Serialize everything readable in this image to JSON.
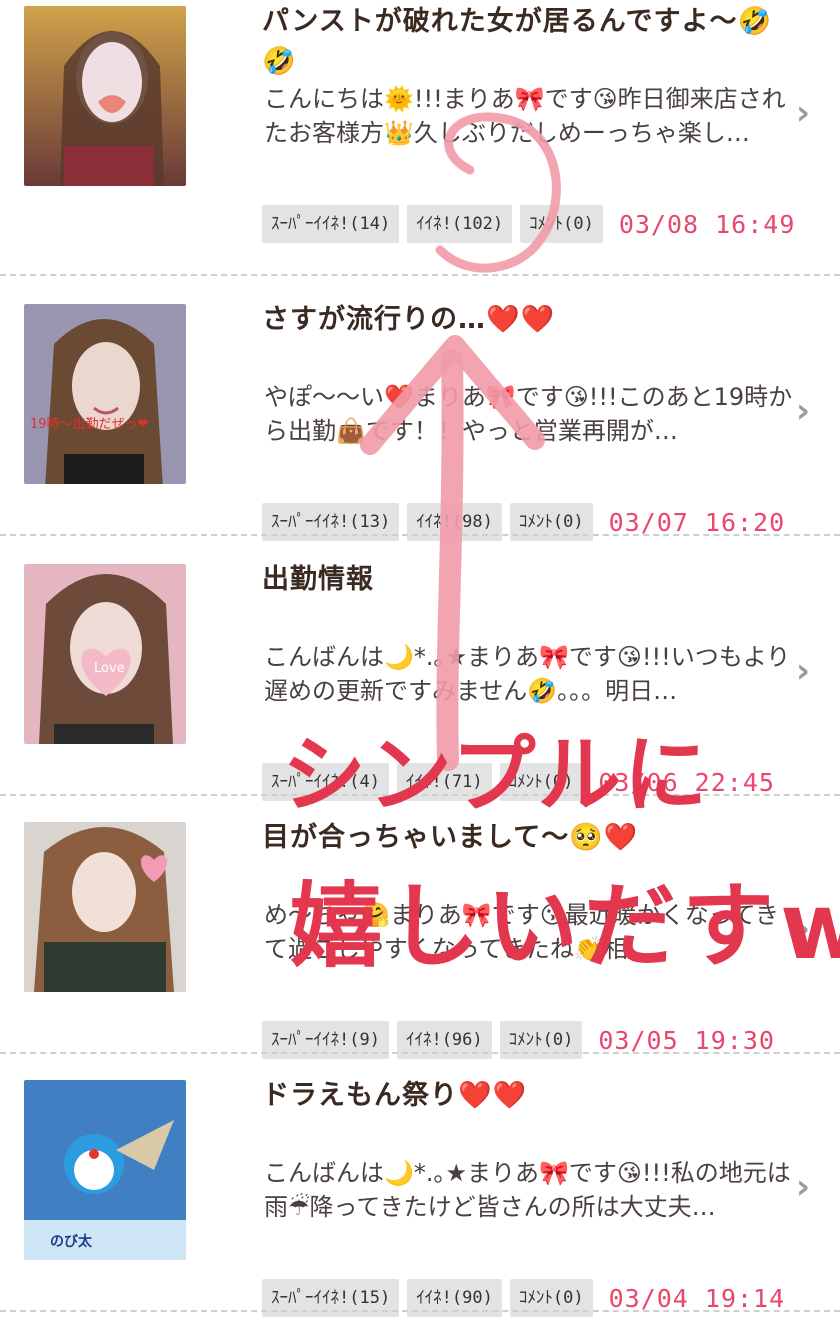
{
  "posts": [
    {
      "title": "パンストが破れた女が居るんですよ〜🤣🤣",
      "excerpt": "こんにちは🌞!!!まりあ🎀です😘昨日御来店されたお客様方👑久しぶりだしめーっちゃ楽し…",
      "super_like": "ｽｰﾊﾟｰｲｲﾈ!(14)",
      "like": "ｲｲﾈ!(102)",
      "comment": "ｺﾒﾝﾄ(0)",
      "date": "03/08 16:49",
      "thumb_color": "#c9a54b"
    },
    {
      "title": "さすが流行りの…❤️❤️",
      "excerpt": "やぽ〜〜い❤️まりあ🎀です😘!!!このあと19時から出勤👜です！！やっと営業再開が…",
      "super_like": "ｽｰﾊﾟｰｲｲﾈ!(13)",
      "like": "ｲｲﾈ!(98)",
      "comment": "ｺﾒﾝﾄ(0)",
      "date": "03/07 16:20",
      "thumb_color": "#8f8ba6",
      "thumb_caption": "19時〜出勤だぜっ❤"
    },
    {
      "title": "出勤情報",
      "excerpt": "こんばんは🌙*.｡★まりあ🎀です😘!!!いつもより遅めの更新ですみません🤣。。。明日…",
      "super_like": "ｽｰﾊﾟｰｲｲﾈ!(4)",
      "like": "ｲｲﾈ!(71)",
      "comment": "ｺﾒﾝﾄ(0)",
      "date": "03/06 22:45",
      "thumb_color": "#d8a6b2",
      "thumb_caption": "Love"
    },
    {
      "title": "目が合っちゃいまして〜🥺❤️",
      "excerpt": "め〜ちゃ🤗まりあ🎀です😘最近暖かくなってきて過ごしやすくなってきたね👏相…",
      "super_like": "ｽｰﾊﾟｰｲｲﾈ!(9)",
      "like": "ｲｲﾈ!(96)",
      "comment": "ｺﾒﾝﾄ(0)",
      "date": "03/05 19:30",
      "thumb_color": "#b99a86"
    },
    {
      "title": "ドラえもん祭り❤️❤️",
      "excerpt": "こんばんは🌙*.｡★まりあ🎀です😘!!!私の地元は雨☔降ってきたけど皆さんの所は大丈夫…",
      "super_like": "ｽｰﾊﾟｰｲｲﾈ!(15)",
      "like": "ｲｲﾈ!(90)",
      "comment": "ｺﾒﾝﾄ(0)",
      "date": "03/04 19:14",
      "thumb_color": "#3f7fc2"
    }
  ],
  "annotation": {
    "line1": "シンプルに",
    "line2": "嬉しいだすw",
    "color": "#e2374e"
  }
}
